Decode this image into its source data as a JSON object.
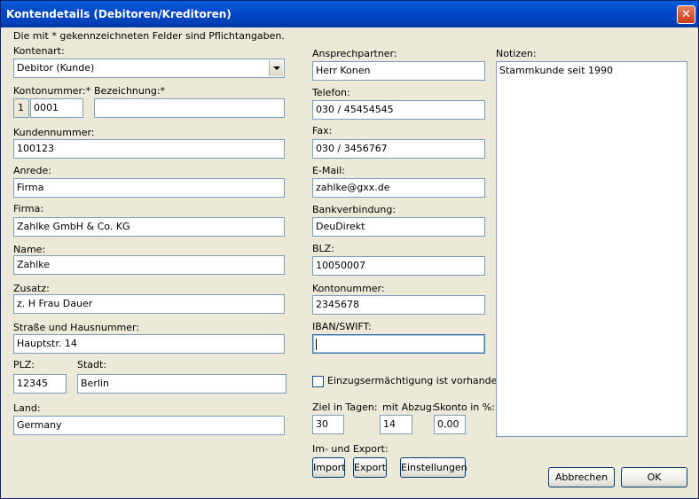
{
  "window": {
    "title": "Kontendetails (Debitoren/Kreditoren)",
    "close_glyph": "✕"
  },
  "hint": "Die mit * gekennzeichneten Felder sind Pflichtangaben.",
  "left": {
    "kontenart": {
      "label": "Kontenart:",
      "value": "Debitor (Kunde)"
    },
    "kontonummer": {
      "label": "Kontonummer:*",
      "prefix": "1",
      "value": "0001"
    },
    "bezeichnung": {
      "label": "Bezeichnung:*",
      "value": ""
    },
    "kundennummer": {
      "label": "Kundennummer:",
      "value": "100123"
    },
    "anrede": {
      "label": "Anrede:",
      "value": "Firma"
    },
    "firma": {
      "label": "Firma:",
      "value": "Zahlke GmbH & Co. KG"
    },
    "name": {
      "label": "Name:",
      "value": "Zahlke"
    },
    "zusatz": {
      "label": "Zusatz:",
      "value": "z. H Frau Dauer"
    },
    "strasse": {
      "label": "Straße und Hausnummer:",
      "value": "Hauptstr. 14"
    },
    "plz": {
      "label": "PLZ:",
      "value": "12345"
    },
    "stadt": {
      "label": "Stadt:",
      "value": "Berlin"
    },
    "land": {
      "label": "Land:",
      "value": "Germany"
    }
  },
  "middle": {
    "ansprechpartner": {
      "label": "Ansprechpartner:",
      "value": "Herr Konen"
    },
    "telefon": {
      "label": "Telefon:",
      "value": "030 / 45454545"
    },
    "fax": {
      "label": "Fax:",
      "value": "030 / 3456767"
    },
    "email": {
      "label": "E-Mail:",
      "value": "zahlke@gxx.de"
    },
    "bankverbindung": {
      "label": "Bankverbindung:",
      "value": "DeuDirekt"
    },
    "blz": {
      "label": "BLZ:",
      "value": "10050007"
    },
    "kontonummer": {
      "label": "Kontonummer:",
      "value": "2345678"
    },
    "iban": {
      "label": "IBAN/SWIFT:",
      "value": ""
    },
    "einzug": {
      "label": "Einzugsermächtigung ist vorhanden",
      "checked": false
    },
    "ziel": {
      "label": "Ziel in Tagen:",
      "value": "30"
    },
    "abzug": {
      "label": "mit Abzug:",
      "value": "14"
    },
    "skonto": {
      "label": "Skonto in %:",
      "value": "0,00"
    },
    "export_section": {
      "label": "Im- und Export:"
    },
    "buttons": {
      "import": "Import",
      "export": "Export",
      "einstellungen": "Einstellungen"
    }
  },
  "right": {
    "notizen": {
      "label": "Notizen:",
      "value": "Stammkunde seit 1990"
    }
  },
  "footer": {
    "cancel": "Abbrechen",
    "ok": "OK"
  }
}
